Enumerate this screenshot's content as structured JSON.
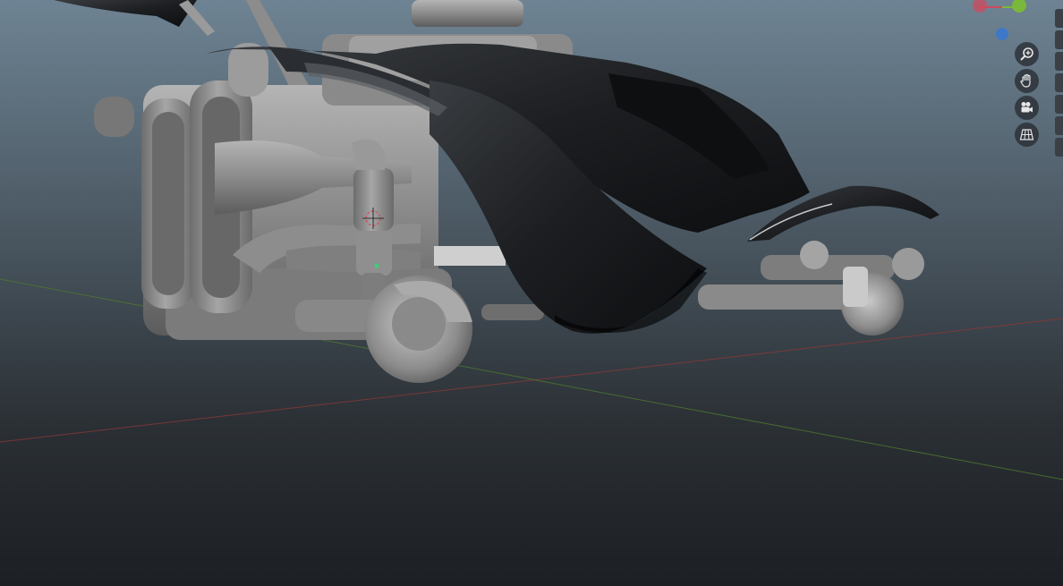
{
  "viewport": {
    "background_top": "#6e8393",
    "background_bottom": "#1c1f23"
  },
  "gizmo": {
    "x_color": "#d04a5c",
    "y_color": "#7ab83c",
    "z_color": "#3f78c8"
  },
  "nav_controls": [
    {
      "name": "zoom-button",
      "icon": "zoom-in-icon"
    },
    {
      "name": "pan-button",
      "icon": "hand-icon"
    },
    {
      "name": "camera-view-button",
      "icon": "camera-icon"
    },
    {
      "name": "perspective-toggle-button",
      "icon": "grid-icon"
    }
  ],
  "scene": {
    "object": "motorbike-chassis-model",
    "axis_x_color": "#8a3838",
    "axis_y_color": "#4e7a2c"
  }
}
